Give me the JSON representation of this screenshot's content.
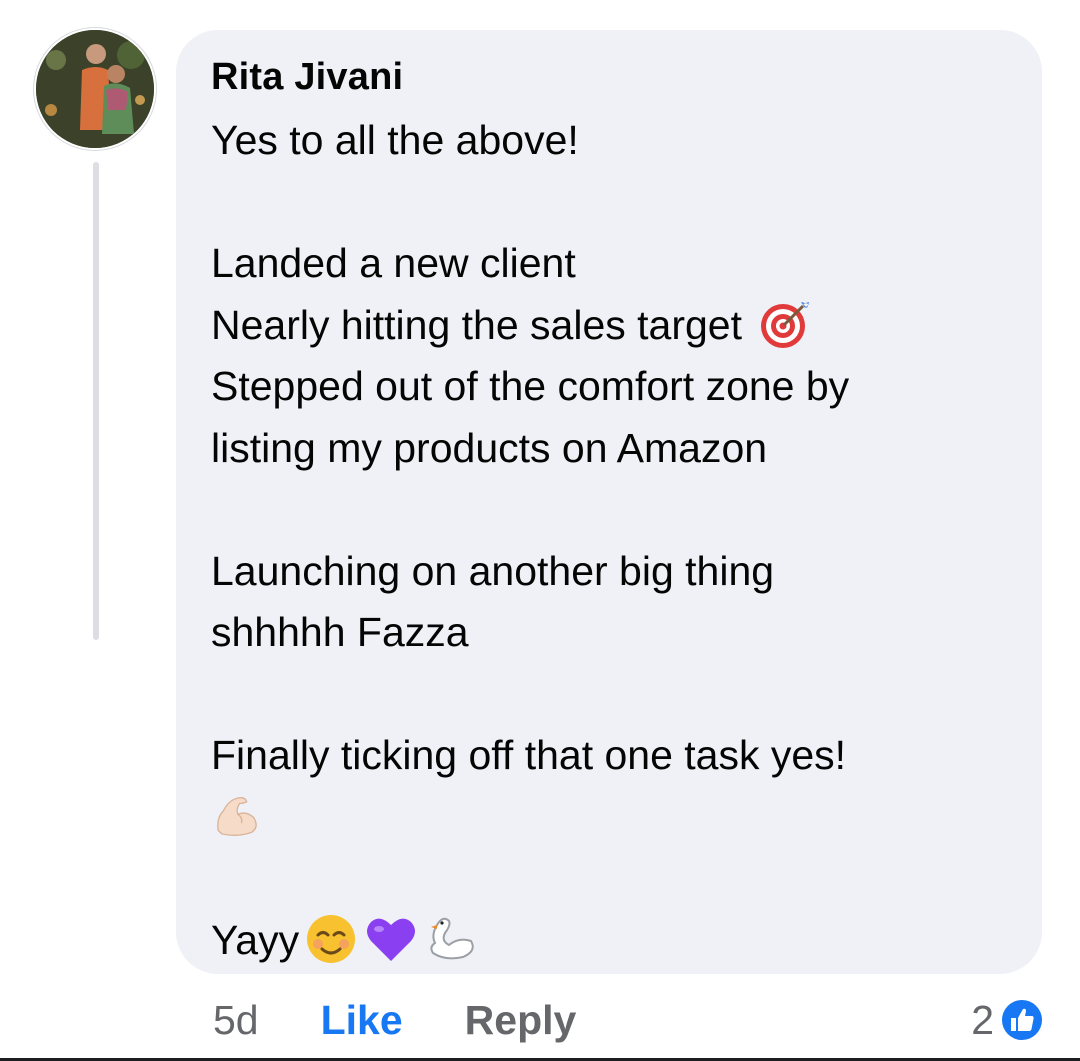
{
  "comment": {
    "author": "Rita Jivani",
    "lines": [
      {
        "text": "Yes to all the above!"
      },
      {
        "text": ""
      },
      {
        "text": "Landed a new client"
      },
      {
        "text": "Nearly hitting the sales target ",
        "emoji": [
          "direct-hit-icon"
        ]
      },
      {
        "text": "Stepped out of the comfort zone by"
      },
      {
        "text": "listing my products on Amazon"
      },
      {
        "text": ""
      },
      {
        "text": "Launching on another big thing"
      },
      {
        "text": "shhhhh Fazza"
      },
      {
        "text": ""
      },
      {
        "text": "Finally ticking off that one task yes!"
      },
      {
        "text": "",
        "emoji": [
          "flexed-biceps-icon"
        ]
      },
      {
        "text": ""
      },
      {
        "text": "Yayy",
        "emoji": [
          "smiling-face-icon",
          "purple-heart-icon",
          "swan-icon"
        ]
      }
    ]
  },
  "actions": {
    "time": "5d",
    "like_label": "Like",
    "reply_label": "Reply"
  },
  "reactions": {
    "count": "2",
    "icon": "like-reaction-icon"
  },
  "colors": {
    "bubble": "#f0f1f6",
    "like_blue": "#1877f2",
    "muted": "#65676b"
  }
}
